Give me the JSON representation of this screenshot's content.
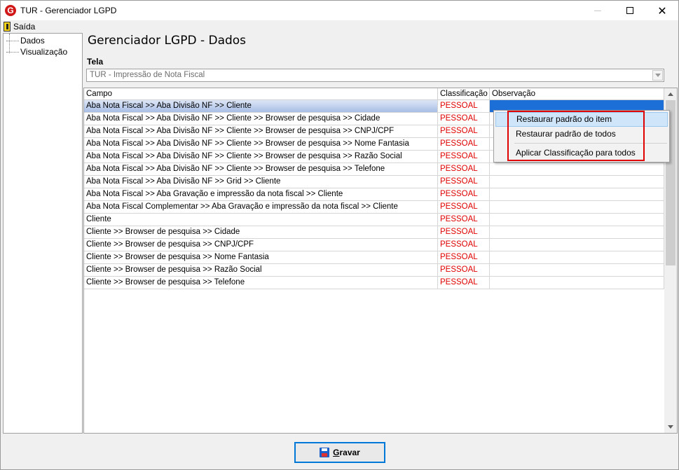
{
  "window": {
    "title": "TUR - Gerenciador LGPD",
    "app_icon_letter": "G",
    "close_glyph": "✕"
  },
  "menubar": {
    "exit_label": "Saída"
  },
  "tree": {
    "items": [
      "Dados",
      "Visualização"
    ]
  },
  "main": {
    "title": "Gerenciador LGPD - Dados",
    "tela_label": "Tela",
    "tela_value": "TUR - Impressão de Nota Fiscal"
  },
  "grid": {
    "columns": [
      "Campo",
      "Classificação",
      "Observação"
    ],
    "rows": [
      {
        "campo": "Aba Nota Fiscal >> Aba Divisão NF >> Cliente",
        "classificacao": "PESSOAL",
        "observacao": ""
      },
      {
        "campo": "Aba Nota Fiscal >> Aba Divisão NF >> Cliente >> Browser de pesquisa >> Cidade",
        "classificacao": "PESSOAL",
        "observacao": ""
      },
      {
        "campo": "Aba Nota Fiscal >> Aba Divisão NF >> Cliente >> Browser de pesquisa >> CNPJ/CPF",
        "classificacao": "PESSOAL",
        "observacao": ""
      },
      {
        "campo": "Aba Nota Fiscal >> Aba Divisão NF >> Cliente >> Browser de pesquisa >> Nome Fantasia",
        "classificacao": "PESSOAL",
        "observacao": ""
      },
      {
        "campo": "Aba Nota Fiscal >> Aba Divisão NF >> Cliente >> Browser de pesquisa >> Razão Social",
        "classificacao": "PESSOAL",
        "observacao": ""
      },
      {
        "campo": "Aba Nota Fiscal >> Aba Divisão NF >> Cliente >> Browser de pesquisa >> Telefone",
        "classificacao": "PESSOAL",
        "observacao": ""
      },
      {
        "campo": "Aba Nota Fiscal >> Aba Divisão NF >> Grid >> Cliente",
        "classificacao": "PESSOAL",
        "observacao": ""
      },
      {
        "campo": "Aba Nota Fiscal >> Aba Gravação e impressão da nota fiscal >> Cliente",
        "classificacao": "PESSOAL",
        "observacao": ""
      },
      {
        "campo": "Aba Nota Fiscal Complementar >> Aba Gravação e impressão da nota fiscal >> Cliente",
        "classificacao": "PESSOAL",
        "observacao": ""
      },
      {
        "campo": "Cliente",
        "classificacao": "PESSOAL",
        "observacao": ""
      },
      {
        "campo": "Cliente >> Browser de pesquisa >> Cidade",
        "classificacao": "PESSOAL",
        "observacao": ""
      },
      {
        "campo": "Cliente >> Browser de pesquisa >> CNPJ/CPF",
        "classificacao": "PESSOAL",
        "observacao": ""
      },
      {
        "campo": "Cliente >> Browser de pesquisa >> Nome Fantasia",
        "classificacao": "PESSOAL",
        "observacao": ""
      },
      {
        "campo": "Cliente >> Browser de pesquisa >> Razão Social",
        "classificacao": "PESSOAL",
        "observacao": ""
      },
      {
        "campo": "Cliente >> Browser de pesquisa >> Telefone",
        "classificacao": "PESSOAL",
        "observacao": ""
      }
    ]
  },
  "context_menu": {
    "items": [
      "Restaurar padrão do item",
      "Restaurar padrão de todos",
      "Aplicar Classificação para todos"
    ]
  },
  "footer": {
    "save_label": "Gravar"
  },
  "colors": {
    "classification_text": "#e00000",
    "highlight_border": "#e00000",
    "selection_blue": "#1d6fd8",
    "menu_hover": "#cfe5f9"
  }
}
